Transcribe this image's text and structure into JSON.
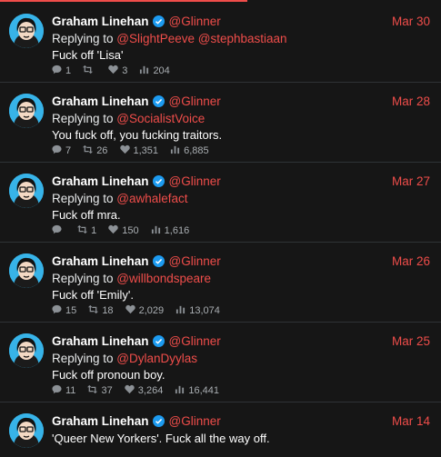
{
  "colors": {
    "accent": "#ef4d4a",
    "background": "#161616",
    "verified": "#1d9bf0"
  },
  "tweets": [
    {
      "name": "Graham Linehan",
      "handle": "@Glinner",
      "date": "Mar 30",
      "reply_prefix": "Replying to ",
      "reply_to": "@SlightPeeve @stephbastiaan",
      "text": "Fuck off 'Lisa'",
      "replies": "1",
      "retweets": "",
      "likes": "3",
      "views": "204"
    },
    {
      "name": "Graham Linehan",
      "handle": "@Glinner",
      "date": "Mar 28",
      "reply_prefix": "Replying to ",
      "reply_to": "@SocialistVoice",
      "text": "You fuck off, you fucking traitors.",
      "replies": "7",
      "retweets": "26",
      "likes": "1,351",
      "views": "6,885"
    },
    {
      "name": "Graham Linehan",
      "handle": "@Glinner",
      "date": "Mar 27",
      "reply_prefix": "Replying to ",
      "reply_to": "@awhalefact",
      "text": "Fuck off mra.",
      "replies": "",
      "retweets": "1",
      "likes": "150",
      "views": "1,616"
    },
    {
      "name": "Graham Linehan",
      "handle": "@Glinner",
      "date": "Mar 26",
      "reply_prefix": "Replying to ",
      "reply_to": "@willbondspeare",
      "text": "Fuck off 'Emily'.",
      "replies": "15",
      "retweets": "18",
      "likes": "2,029",
      "views": "13,074"
    },
    {
      "name": "Graham Linehan",
      "handle": "@Glinner",
      "date": "Mar 25",
      "reply_prefix": "Replying to ",
      "reply_to": "@DylanDyylas",
      "text": "Fuck off pronoun boy.",
      "replies": "11",
      "retweets": "37",
      "likes": "3,264",
      "views": "16,441"
    },
    {
      "name": "Graham Linehan",
      "handle": "@Glinner",
      "date": "Mar 14",
      "text": "'Queer New Yorkers'. Fuck all the way off."
    }
  ]
}
